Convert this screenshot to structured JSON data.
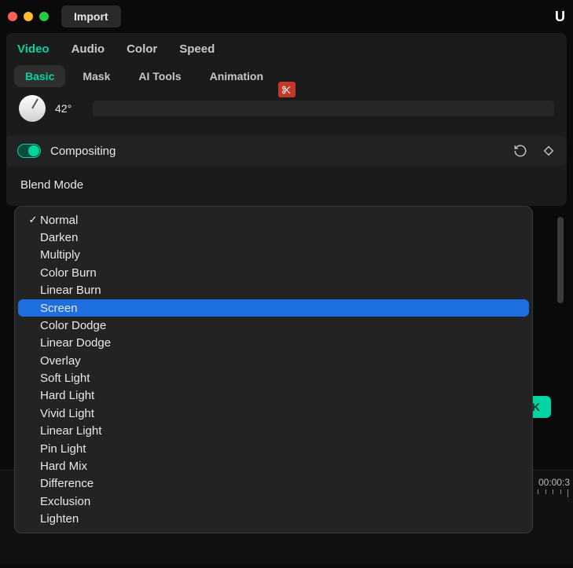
{
  "titlebar": {
    "import_label": "Import",
    "right_char": "U"
  },
  "tabs_primary": [
    {
      "label": "Video",
      "active": true
    },
    {
      "label": "Audio",
      "active": false
    },
    {
      "label": "Color",
      "active": false
    },
    {
      "label": "Speed",
      "active": false
    }
  ],
  "tabs_secondary": [
    {
      "label": "Basic",
      "active": true
    },
    {
      "label": "Mask",
      "active": false
    },
    {
      "label": "AI Tools",
      "active": false
    },
    {
      "label": "Animation",
      "active": false
    }
  ],
  "angle": {
    "value": "42°"
  },
  "compositing": {
    "title": "Compositing",
    "enabled": true
  },
  "blend_mode": {
    "label": "Blend Mode",
    "selected": "Normal",
    "highlighted": "Screen",
    "options": [
      "Normal",
      "Darken",
      "Multiply",
      "Color Burn",
      "Linear Burn",
      "Screen",
      "Color Dodge",
      "Linear Dodge",
      "Overlay",
      "Soft Light",
      "Hard Light",
      "Vivid Light",
      "Linear Light",
      "Pin Light",
      "Hard Mix",
      "Difference",
      "Exclusion",
      "Lighten"
    ]
  },
  "dialog": {
    "ok_label": "OK"
  },
  "timeline": {
    "timecode": "00:00:3"
  }
}
